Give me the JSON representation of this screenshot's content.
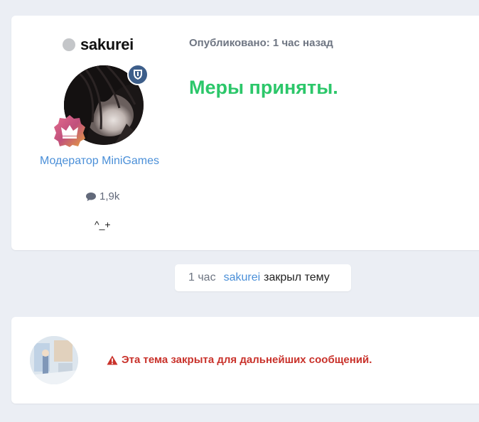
{
  "post": {
    "author": "sakurei",
    "meta": "Опубликовано: 1 час назад",
    "body": "Меры приняты.",
    "role": "Модератор MiniGames",
    "message_count": "1,9k",
    "signature": "^_+",
    "icons": {
      "status": "status-dot-icon",
      "shield": "shield-icon",
      "crown": "crown-icon",
      "comment": "comment-icon"
    }
  },
  "event": {
    "time": "1 час",
    "user": "sakurei",
    "action": "закрыл тему"
  },
  "closed_notice": {
    "text": "Эта тема закрыта для дальнейших сообщений.",
    "icon": "warning-icon"
  },
  "colors": {
    "background": "#ebeef4",
    "post_text": "#2cc76a",
    "link": "#4a8fd8",
    "warning": "#c9322b",
    "shield_badge": "#3d5e8a"
  }
}
